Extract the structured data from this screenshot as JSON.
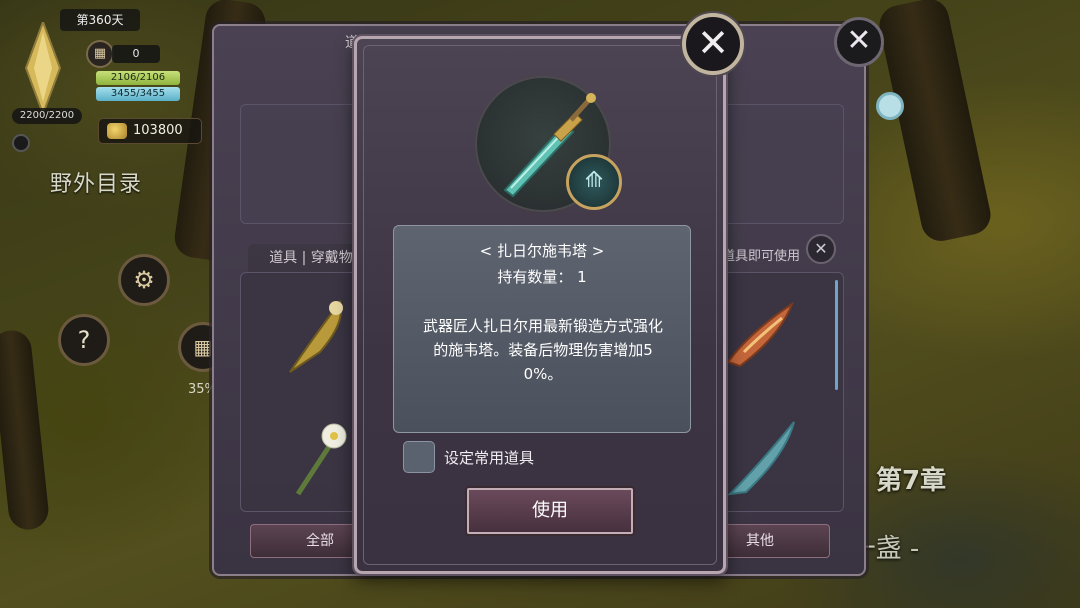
{
  "hud": {
    "day": "第360天",
    "crystal_value": "2200/2200",
    "calendar_count": "0",
    "hp": "2106/2106",
    "mp": "3455/3455",
    "gold": "103800",
    "field_title": "野外目录",
    "help_glyph": "?",
    "progress_pct": "35%",
    "chapter": "第7章",
    "chapter_sub": "- 一盏 -"
  },
  "warehouse": {
    "title": "道具保管箱",
    "tab_label": "道具 | 穿戴物品",
    "hint": "道具即可使用",
    "btn_all": "全部",
    "btn_other": "其他"
  },
  "dialog": {
    "item_name": "< 扎日尔施韦塔 >",
    "count_line": "持有数量： 1",
    "description": "武器匠人扎日尔用最新锻造方式强化的施韦塔。装备后物理伤害增加50%。",
    "checkbox_label": "设定常用道具",
    "use_button": "使用"
  },
  "icons": {
    "close": "close-icon",
    "gear": "gear-icon",
    "calendar": "calendar-icon",
    "gold": "gold-icon",
    "map_pin": "map-pin-icon",
    "weapon": "sword-icon",
    "type_badge": "spear-type-icon"
  },
  "colors": {
    "dialog_border": "#b7a6b0",
    "use_button_bg": "#5a3c4c",
    "desc_bg": "#56606c",
    "hp_green": "#a8c85a",
    "mp_blue": "#7ec8da"
  }
}
